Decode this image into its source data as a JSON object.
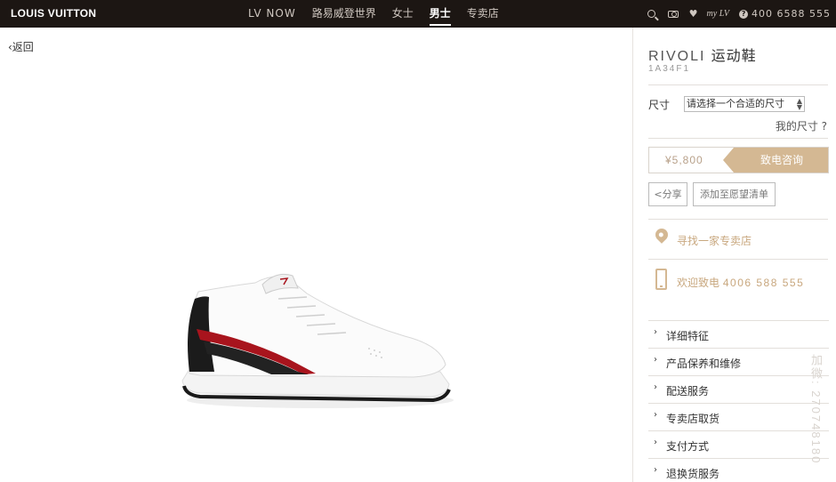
{
  "header": {
    "brand": "LOUIS VUITTON",
    "nav": [
      {
        "label": "LV NOW"
      },
      {
        "label": "路易威登世界"
      },
      {
        "label": "女士"
      },
      {
        "label": "男士",
        "active": true
      },
      {
        "label": "专卖店"
      }
    ],
    "utility": {
      "mylv": "my LV",
      "help": "?",
      "phone": "400 6588 555"
    }
  },
  "back_link": "‹返回",
  "product": {
    "name_en": "RIVOLI",
    "name_cn": "运动鞋",
    "code": "1A34F1",
    "size_label": "尺寸",
    "size_placeholder": "请选择一个合适的尺寸",
    "my_size": "我的尺寸 ?",
    "price": "¥5,800",
    "call_button": "致电咨询",
    "share_button": "<分享",
    "wishlist_button": "添加至愿望清单",
    "find_store": "寻找一家专卖店",
    "call_text": "欢迎致电",
    "call_number": "4006 588 555",
    "accordion": [
      {
        "label": "详细特征"
      },
      {
        "label": "产品保养和维修"
      },
      {
        "label": "配送服务"
      },
      {
        "label": "专卖店取货"
      },
      {
        "label": "支付方式"
      },
      {
        "label": "退换货服务"
      }
    ]
  },
  "watermark": "加微: 27074818​0",
  "colors": {
    "topbar": "#1c1613",
    "accent": "#d4b893"
  }
}
